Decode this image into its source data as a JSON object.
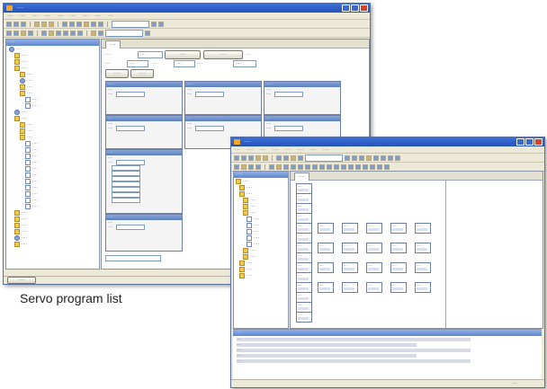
{
  "caption": "Servo program list",
  "window1": {
    "title": "····",
    "menu": [
      "····",
      "····",
      "····",
      "····",
      "····",
      "····",
      "····",
      "····",
      "····"
    ],
    "project_panel_title": "····",
    "tab_label": "····",
    "tree_items": [
      "····",
      "····",
      "····",
      "····",
      "····",
      "····",
      "····",
      "····",
      "····",
      "····",
      "····",
      "····",
      "····",
      "····",
      "····",
      "····",
      "····",
      "····",
      "····",
      "····",
      "····",
      "····",
      "····",
      "····",
      "····",
      "····",
      "····",
      "····",
      "····",
      "····",
      "····",
      "····"
    ],
    "top_labels": {
      "num_programs_label": "····",
      "num_programs_value": "····",
      "prog_button": "····",
      "display_button": "····",
      "free_label": "····",
      "free_value": "····",
      "total_label": "····",
      "total_value": "····",
      "range_label": "····",
      "range_value": "····",
      "btn_a": "····",
      "btn_b": "····",
      "link_a": "····"
    },
    "cells": [
      {
        "header": "····",
        "l1": "····",
        "l2": "····"
      },
      {
        "header": "····",
        "l1": "····",
        "l2": "····"
      },
      {
        "header": "····",
        "l1": "····",
        "l2": "····"
      },
      {
        "header": "····",
        "l1": "····",
        "l2": "····"
      },
      {
        "header": "····",
        "l1": "····",
        "l2": "····"
      },
      {
        "header": "····",
        "l1": "····",
        "l2": "····"
      },
      {
        "header": "····",
        "l1": "····",
        "l2": "····"
      },
      {
        "header": "····",
        "l1": "····",
        "l2": "····"
      }
    ],
    "bottom_tab": "····"
  },
  "window2": {
    "title": "····",
    "menu": [
      "····",
      "····",
      "····",
      "····",
      "····",
      "····",
      "····",
      "····"
    ],
    "project_panel_title": "····",
    "tab_label": "····",
    "tree_items": [
      "····",
      "····",
      "····",
      "····",
      "····",
      "····",
      "····",
      "····",
      "····",
      "····",
      "····",
      "····",
      "····",
      "····",
      "····",
      "····"
    ],
    "blocks_col1": [
      "····",
      "····",
      "····",
      "····",
      "····",
      "····",
      "····",
      "····",
      "····",
      "····",
      "····",
      "····",
      "····",
      "····"
    ],
    "blocks_grid": [
      "····",
      "····",
      "····",
      "····",
      "····",
      "····",
      "····",
      "····",
      "····",
      "····",
      "····",
      "····",
      "····",
      "····",
      "····",
      "····",
      "····",
      "····",
      "····",
      "····"
    ],
    "output_title": "····",
    "output_lines": [
      "····",
      "····",
      "····",
      "····",
      "····"
    ],
    "status_text": "····"
  },
  "colors": {
    "titlebar": "#2452b8",
    "chrome": "#ece9d8",
    "cell_header": "#5b7fc2"
  }
}
